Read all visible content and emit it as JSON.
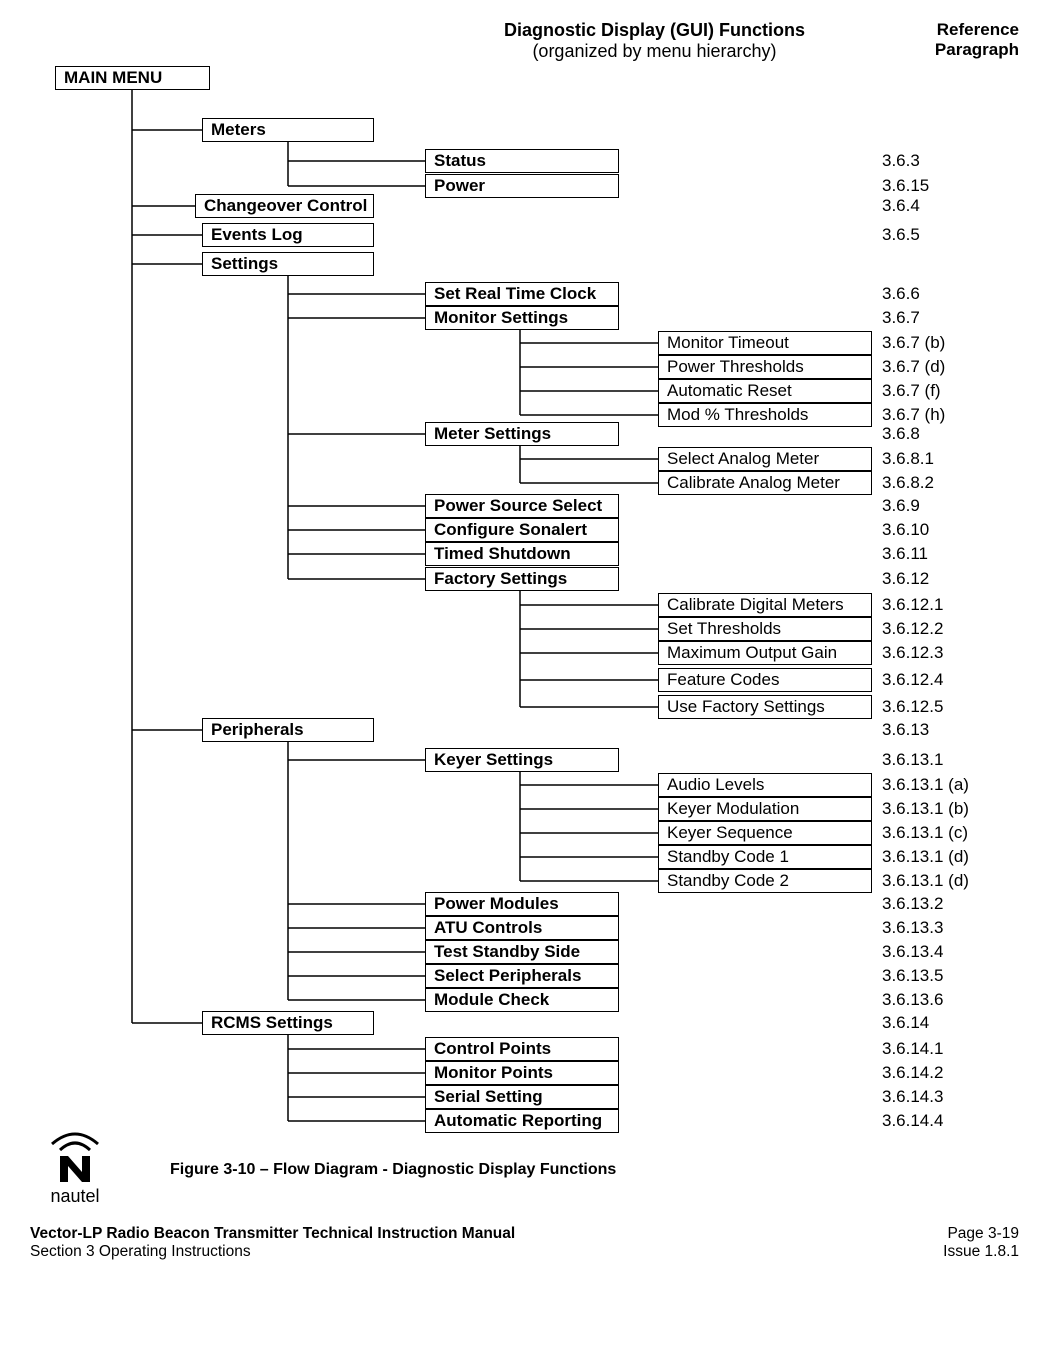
{
  "header": {
    "title1": "Diagnostic Display (GUI) Functions",
    "title2": "(organized by menu hierarchy)",
    "ref1": "Reference",
    "ref2": "Paragraph"
  },
  "root": "MAIN MENU",
  "l1": {
    "meters": "Meters",
    "changeover": "Changeover Control",
    "eventslog": "Events Log",
    "settings": "Settings",
    "peripherals": "Peripherals",
    "rcms": "RCMS Settings"
  },
  "l2": {
    "status": "Status",
    "power": "Power",
    "srtc": "Set Real Time Clock",
    "monset": "Monitor Settings",
    "meterset": "Meter Settings",
    "psrc": "Power Source Select",
    "sonalert": "Configure Sonalert",
    "timed": "Timed Shutdown",
    "factory": "Factory Settings",
    "keyer": "Keyer Settings",
    "pmod": "Power Modules",
    "atu": "ATU Controls",
    "tstby": "Test Standby Side",
    "selper": "Select Peripherals",
    "modchk": "Module Check",
    "ctrlpts": "Control Points",
    "monpts": "Monitor Points",
    "serial": "Serial Setting",
    "autorep": "Automatic Reporting"
  },
  "l3": {
    "montimeout": "Monitor Timeout",
    "pwrthresh": "Power Thresholds",
    "autoreset": "Automatic Reset",
    "modthresh": "Mod % Thresholds",
    "selanalog": "Select Analog Meter",
    "calanalog": "Calibrate Analog Meter",
    "caldigital": "Calibrate Digital Meters",
    "setthresh": "Set Thresholds",
    "maxgain": "Maximum Output Gain",
    "featcodes": "Feature Codes",
    "usefactory": "Use Factory Settings",
    "audiolvl": "Audio Levels",
    "keyermod": "Keyer Modulation",
    "keyerseq": "Keyer Sequence",
    "stby1": "Standby Code 1",
    "stby2": "Standby Code 2"
  },
  "refs": {
    "status": "3.6.3",
    "power": "3.6.15",
    "changeover": "3.6.4",
    "eventslog": "3.6.5",
    "srtc": "3.6.6",
    "monset": "3.6.7",
    "montimeout": "3.6.7 (b)",
    "pwrthresh": "3.6.7 (d)",
    "autoreset": "3.6.7 (f)",
    "modthresh": "3.6.7 (h)",
    "meterset": "3.6.8",
    "selanalog": "3.6.8.1",
    "calanalog": "3.6.8.2",
    "psrc": "3.6.9",
    "sonalert": "3.6.10",
    "timed": "3.6.11",
    "factory": "3.6.12",
    "caldigital": "3.6.12.1",
    "setthresh": "3.6.12.2",
    "maxgain": "3.6.12.3",
    "featcodes": "3.6.12.4",
    "usefactory": "3.6.12.5",
    "peripherals": "3.6.13",
    "keyer": "3.6.13.1",
    "audiolvl": "3.6.13.1 (a)",
    "keyermod": "3.6.13.1 (b)",
    "keyerseq": "3.6.13.1 (c)",
    "stby1": "3.6.13.1 (d)",
    "stby2": "3.6.13.1 (d)",
    "pmod": "3.6.13.2",
    "atu": "3.6.13.3",
    "tstby": "3.6.13.4",
    "selper": "3.6.13.5",
    "modchk": "3.6.13.6",
    "rcms": "3.6.14",
    "ctrlpts": "3.6.14.1",
    "monpts": "3.6.14.2",
    "serial": "3.6.14.3",
    "autorep": "3.6.14.4"
  },
  "caption": "Figure 3-10 – Flow Diagram - Diagnostic Display Functions",
  "logo": "nautel",
  "footer": {
    "manual": "Vector-LP Radio Beacon Transmitter Technical Instruction Manual",
    "section": "Section 3 Operating Instructions",
    "page": "Page 3-19",
    "issue": "Issue 1.8.1"
  }
}
